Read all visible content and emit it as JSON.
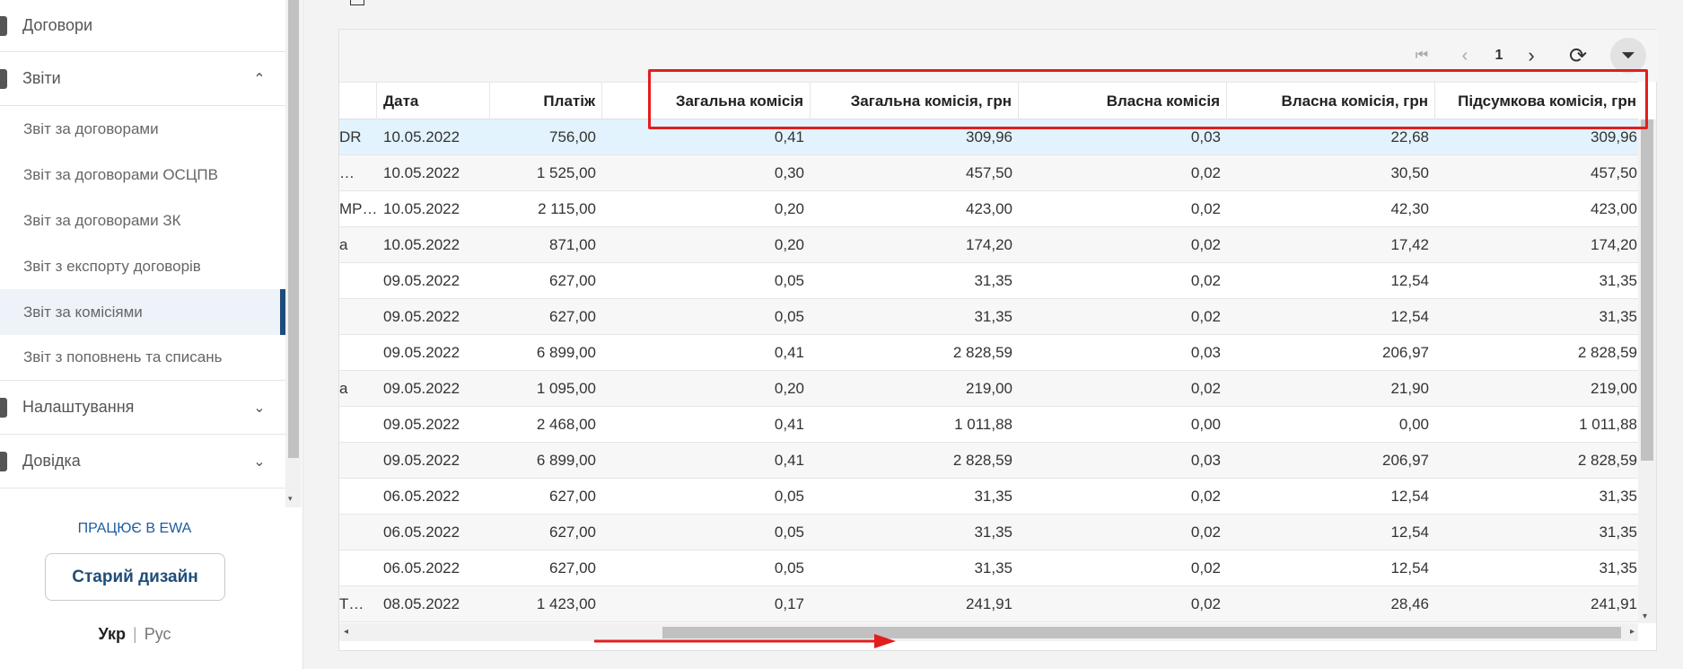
{
  "sidebar": {
    "items": [
      {
        "label": "Договори",
        "type": "nav",
        "chevron": ""
      },
      {
        "label": "Звіти",
        "type": "nav",
        "chevron": "⌃"
      },
      {
        "label": "Звіт за договорами",
        "type": "sub"
      },
      {
        "label": "Звіт за договорами ОСЦПВ",
        "type": "sub"
      },
      {
        "label": "Звіт за договорами ЗК",
        "type": "sub"
      },
      {
        "label": "Звіт з експорту договорів",
        "type": "sub"
      },
      {
        "label": "Звіт за комісіями",
        "type": "sub",
        "active": true
      },
      {
        "label": "Звіт з поповнень та списань",
        "type": "sub"
      },
      {
        "label": "Налаштування",
        "type": "nav",
        "chevron": "⌄"
      },
      {
        "label": "Довідка",
        "type": "nav",
        "chevron": "⌄"
      }
    ],
    "ewa_link": "ПРАЦЮЄ В EWA",
    "old_design_button": "Старий дизайн",
    "lang_ukr": "Укр",
    "lang_separator": "|",
    "lang_rus": "Рус"
  },
  "toolbar": {
    "first_icon": "⏮",
    "prev_icon": "‹",
    "page_number": "1",
    "next_icon": "›",
    "refresh_icon": "⟳",
    "filter_icon": "⏷"
  },
  "table": {
    "headers": [
      "",
      "Дата",
      "Платіж",
      "Загальна комісія",
      "Загальна комісія, грн",
      "Власна комісія",
      "Власна комісія, грн",
      "Підсумкова комісія, грн"
    ],
    "rows": [
      [
        "DR",
        "10.05.2022",
        "756,00",
        "0,41",
        "309,96",
        "0,03",
        "22,68",
        "309,96"
      ],
      [
        "…",
        "10.05.2022",
        "1 525,00",
        "0,30",
        "457,50",
        "0,02",
        "30,50",
        "457,50"
      ],
      [
        "MP…",
        "10.05.2022",
        "2 115,00",
        "0,20",
        "423,00",
        "0,02",
        "42,30",
        "423,00"
      ],
      [
        "a",
        "10.05.2022",
        "871,00",
        "0,20",
        "174,20",
        "0,02",
        "17,42",
        "174,20"
      ],
      [
        "",
        "09.05.2022",
        "627,00",
        "0,05",
        "31,35",
        "0,02",
        "12,54",
        "31,35"
      ],
      [
        "",
        "09.05.2022",
        "627,00",
        "0,05",
        "31,35",
        "0,02",
        "12,54",
        "31,35"
      ],
      [
        "",
        "09.05.2022",
        "6 899,00",
        "0,41",
        "2 828,59",
        "0,03",
        "206,97",
        "2 828,59"
      ],
      [
        "a",
        "09.05.2022",
        "1 095,00",
        "0,20",
        "219,00",
        "0,02",
        "21,90",
        "219,00"
      ],
      [
        "",
        "09.05.2022",
        "2 468,00",
        "0,41",
        "1 011,88",
        "0,00",
        "0,00",
        "1 011,88"
      ],
      [
        "",
        "09.05.2022",
        "6 899,00",
        "0,41",
        "2 828,59",
        "0,03",
        "206,97",
        "2 828,59"
      ],
      [
        "",
        "06.05.2022",
        "627,00",
        "0,05",
        "31,35",
        "0,02",
        "12,54",
        "31,35"
      ],
      [
        "",
        "06.05.2022",
        "627,00",
        "0,05",
        "31,35",
        "0,02",
        "12,54",
        "31,35"
      ],
      [
        "",
        "06.05.2022",
        "627,00",
        "0,05",
        "31,35",
        "0,02",
        "12,54",
        "31,35"
      ],
      [
        "T…",
        "08.05.2022",
        "1 423,00",
        "0,17",
        "241,91",
        "0,02",
        "28,46",
        "241,91"
      ]
    ]
  },
  "scroll_icons": {
    "left": "◂",
    "right": "▸",
    "down": "▾"
  },
  "colors": {
    "accent": "#1f4d7a",
    "annotation": "#e31d1d",
    "selected_row": "#e2f3fd"
  }
}
